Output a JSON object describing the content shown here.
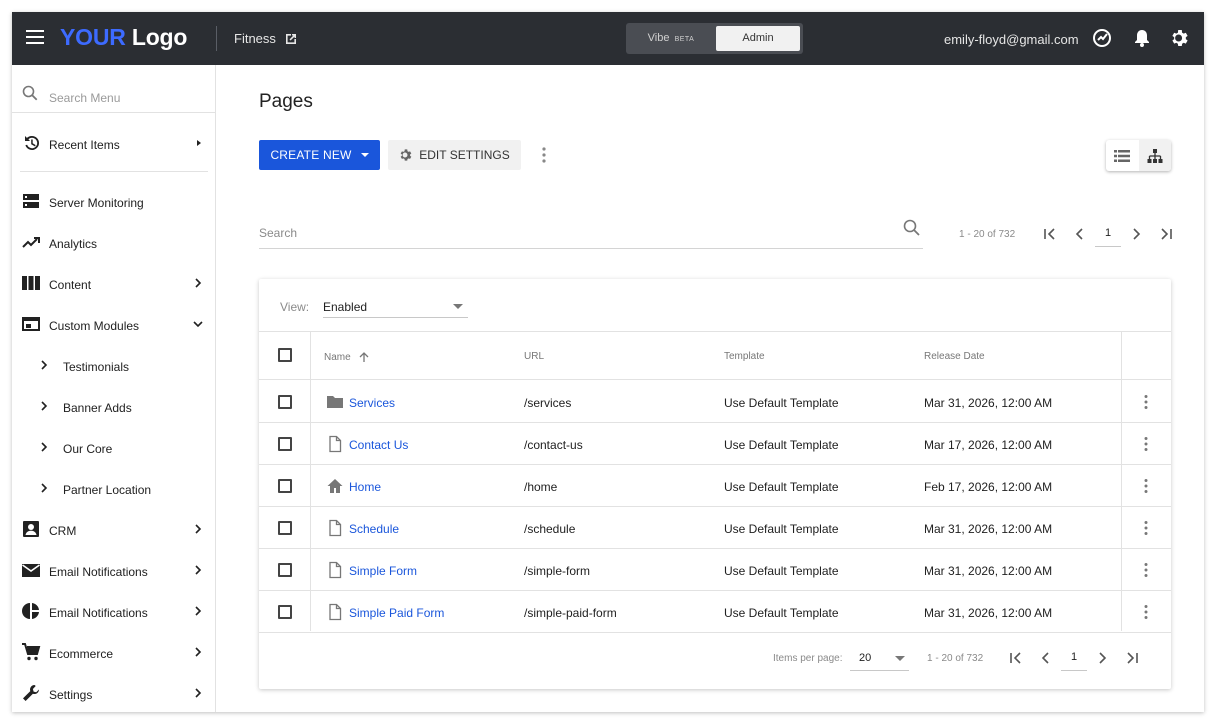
{
  "header": {
    "logo_part1": "YOUR",
    "logo_part2": "Logo",
    "site_name": "Fitness",
    "mode_vibe": "Vibe",
    "mode_vibe_badge": "BETA",
    "mode_admin": "Admin",
    "user_email": "emily-floyd@gmail.com",
    "icons": [
      "menu-icon",
      "external-link-icon",
      "dashboard-gauge-icon",
      "bell-icon",
      "gear-icon"
    ]
  },
  "sidebar": {
    "search_placeholder": "Search Menu",
    "items": [
      {
        "label": "Recent Items",
        "icon": "history-icon"
      },
      {
        "label": "Server Monitoring",
        "icon": "server-icon"
      },
      {
        "label": "Analytics",
        "icon": "trending-up-icon"
      },
      {
        "label": "Content",
        "icon": "columns-icon"
      },
      {
        "label": "Custom Modules",
        "icon": "module-icon"
      },
      {
        "label": "Testimonials"
      },
      {
        "label": "Banner Adds"
      },
      {
        "label": "Our Core"
      },
      {
        "label": "Partner Location"
      },
      {
        "label": "CRM",
        "icon": "contact-icon"
      },
      {
        "label": "Email Notifications",
        "icon": "mail-icon"
      },
      {
        "label": "Email Notifications",
        "icon": "pie-icon"
      },
      {
        "label": "Ecommerce",
        "icon": "cart-icon"
      },
      {
        "label": "Settings",
        "icon": "wrench-icon"
      }
    ]
  },
  "main": {
    "title": "Pages",
    "create_label": "CREATE NEW",
    "edit_label": "EDIT SETTINGS",
    "search_placeholder": "Search",
    "pagination_range": "1 - 20 of 732",
    "current_page": "1",
    "view_label": "View:",
    "view_value": "Enabled",
    "columns": {
      "name": "Name",
      "url": "URL",
      "template": "Template",
      "release": "Release Date"
    },
    "rows": [
      {
        "name": "Services",
        "url": "/services",
        "template": "Use Default Template",
        "date": "Mar 31, 2026, 12:00 AM",
        "icon": "folder-icon"
      },
      {
        "name": "Contact Us",
        "url": "/contact-us",
        "template": "Use Default Template",
        "date": "Mar 17, 2026, 12:00 AM",
        "icon": "file-icon"
      },
      {
        "name": "Home",
        "url": "/home",
        "template": "Use Default Template",
        "date": "Feb 17, 2026, 12:00 AM",
        "icon": "home-icon"
      },
      {
        "name": "Schedule",
        "url": "/schedule",
        "template": "Use Default Template",
        "date": "Mar 31, 2026, 12:00 AM",
        "icon": "file-icon"
      },
      {
        "name": "Simple Form",
        "url": "/simple-form",
        "template": "Use Default Template",
        "date": "Mar 31, 2026, 12:00 AM",
        "icon": "file-icon"
      },
      {
        "name": "Simple Paid Form",
        "url": "/simple-paid-form",
        "template": "Use Default Template",
        "date": "Mar 31, 2026, 12:00 AM",
        "icon": "file-icon"
      }
    ],
    "footer": {
      "items_per_page_label": "Items per page:",
      "items_per_page_value": "20",
      "range": "1 - 20 of 732",
      "current_page": "1"
    }
  },
  "colors": {
    "topbar": "#2b2e33",
    "accent": "#1a56db",
    "logo_accent": "#3d6bff"
  }
}
